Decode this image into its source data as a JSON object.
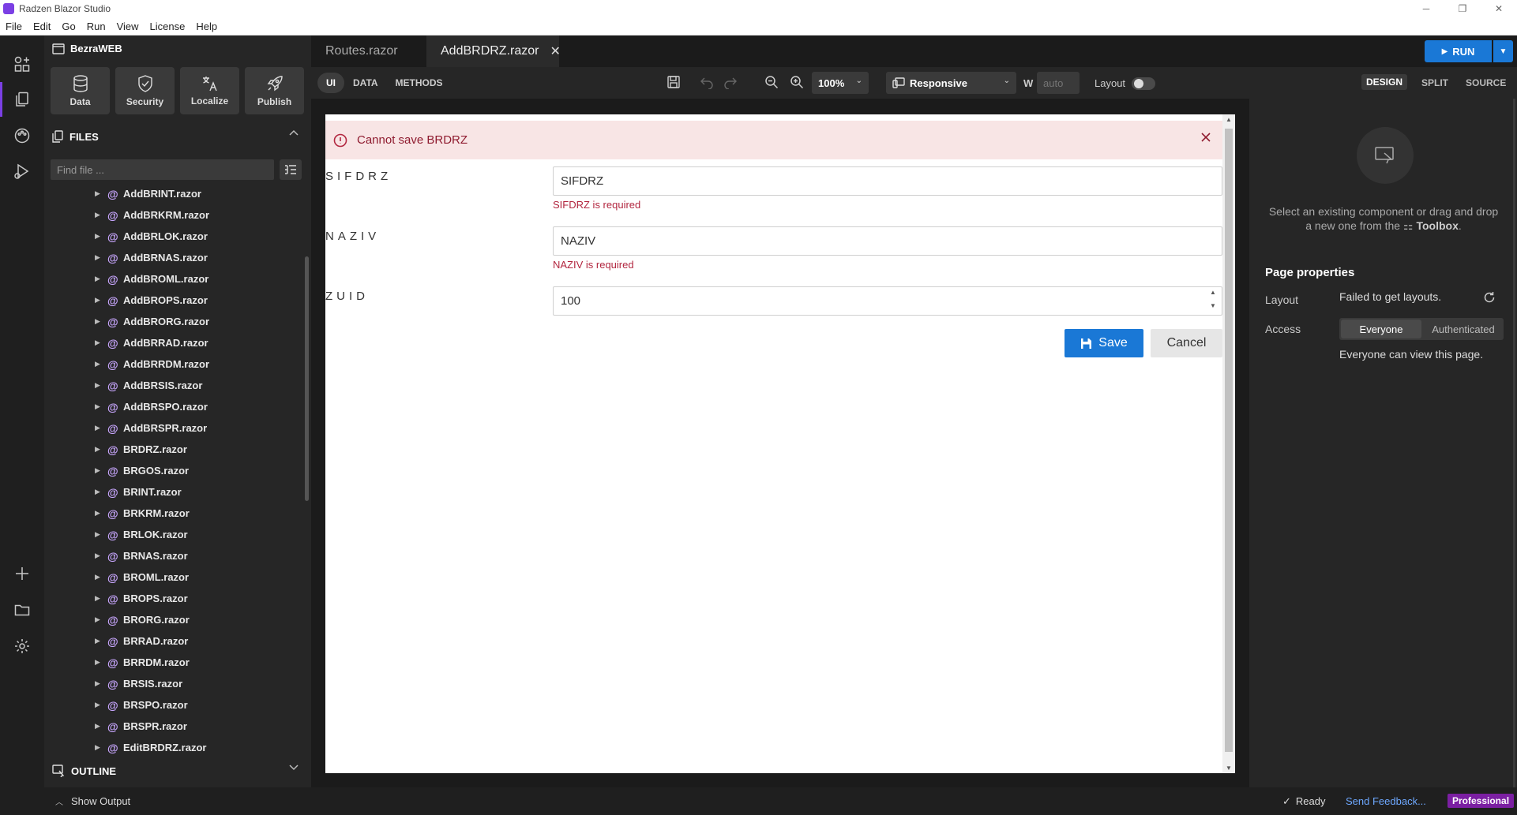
{
  "window": {
    "title": "Radzen Blazor Studio",
    "controls": [
      "─",
      "❐",
      "✕"
    ]
  },
  "menu": [
    "File",
    "Edit",
    "Go",
    "Run",
    "View",
    "License",
    "Help"
  ],
  "sidebar": {
    "project_name": "BezraWEB",
    "tools": [
      {
        "label": "Data",
        "icon": "database-icon"
      },
      {
        "label": "Security",
        "icon": "shield-icon"
      },
      {
        "label": "Localize",
        "icon": "translate-icon"
      },
      {
        "label": "Publish",
        "icon": "rocket-icon"
      }
    ],
    "files_title": "FILES",
    "find_placeholder": "Find file ...",
    "files": [
      "AddBRINT.razor",
      "AddBRKRM.razor",
      "AddBRLOK.razor",
      "AddBRNAS.razor",
      "AddBROML.razor",
      "AddBROPS.razor",
      "AddBRORG.razor",
      "AddBRRAD.razor",
      "AddBRRDM.razor",
      "AddBRSIS.razor",
      "AddBRSPO.razor",
      "AddBRSPR.razor",
      "BRDRZ.razor",
      "BRGOS.razor",
      "BRINT.razor",
      "BRKRM.razor",
      "BRLOK.razor",
      "BRNAS.razor",
      "BROML.razor",
      "BROPS.razor",
      "BRORG.razor",
      "BRRAD.razor",
      "BRRDM.razor",
      "BRSIS.razor",
      "BRSPO.razor",
      "BRSPR.razor",
      "EditBRDRZ.razor"
    ],
    "outline_title": "OUTLINE"
  },
  "tabs": [
    {
      "label": "Routes.razor",
      "active": false
    },
    {
      "label": "AddBRDRZ.razor",
      "active": true
    }
  ],
  "run_label": "RUN",
  "toolbar": {
    "modes": [
      "UI",
      "DATA",
      "METHODS"
    ],
    "zoom": "100%",
    "device": "Responsive",
    "width_label": "W",
    "width_placeholder": "auto",
    "layout_label": "Layout",
    "view_modes": [
      "DESIGN",
      "SPLIT",
      "SOURCE"
    ]
  },
  "form": {
    "alert": "Cannot save BRDRZ",
    "fields": [
      {
        "label": "SIFDRZ",
        "value": "SIFDRZ",
        "error": "SIFDRZ is required"
      },
      {
        "label": "NAZIV",
        "value": "NAZIV",
        "error": "NAZIV is required"
      },
      {
        "label": "ZUID",
        "value": "100",
        "error": ""
      }
    ],
    "save_label": "Save",
    "cancel_label": "Cancel"
  },
  "properties": {
    "hint_text": "Select an existing component or drag and drop a new one from the",
    "hint_toolbox": "Toolbox",
    "hint_end": ".",
    "section_title": "Page properties",
    "layout_label": "Layout",
    "layout_value": "Failed to get layouts.",
    "access_label": "Access",
    "access_options": [
      "Everyone",
      "Authenticated"
    ],
    "access_selected": "Everyone",
    "access_note": "Everyone can view this page."
  },
  "status": {
    "show_output": "Show Output",
    "ready": "Ready",
    "feedback": "Send Feedback...",
    "edition": "Professional"
  },
  "colors": {
    "accent": "#1a78d6",
    "brand": "#7b3fe4",
    "error": "#b2263f",
    "alert_bg": "#f8e5e5"
  }
}
